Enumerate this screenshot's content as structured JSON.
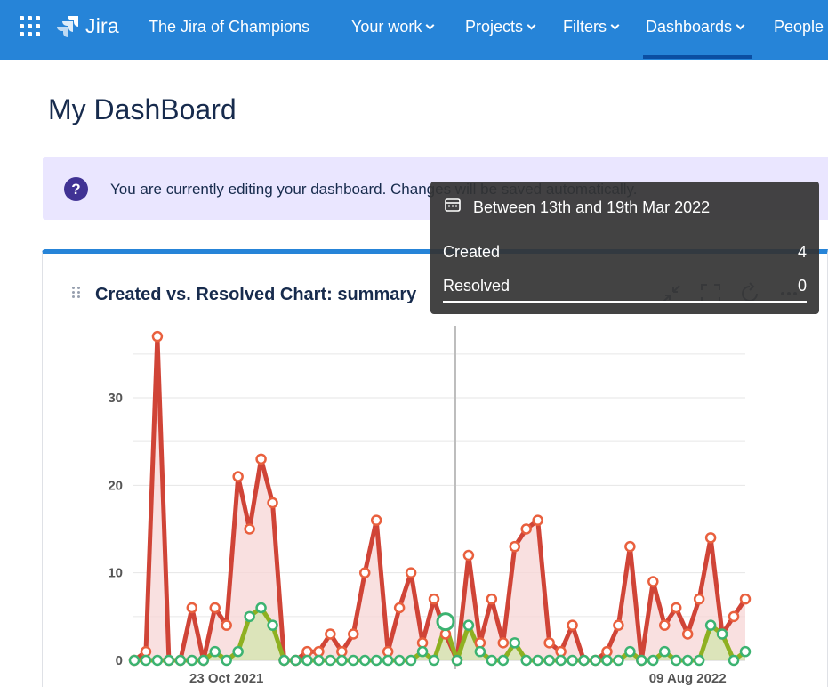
{
  "nav": {
    "product_name": "Jira",
    "site_name": "The Jira of Champions",
    "items": [
      {
        "label": "Your work"
      },
      {
        "label": "Projects"
      },
      {
        "label": "Filters"
      },
      {
        "label": "Dashboards"
      },
      {
        "label": "People"
      }
    ],
    "active": "Dashboards",
    "icons": [
      "apps-grid-icon",
      "jira-logo-icon",
      "chevron-down-icon"
    ],
    "colors": {
      "bar": "#2684d8",
      "active_indicator": "#0b4ea2"
    }
  },
  "page": {
    "title": "My DashBoard"
  },
  "banner": {
    "text": "You are currently editing your dashboard. Changes will be saved automatically.",
    "icon": "question-icon",
    "colors": {
      "background": "#eae6ff",
      "icon": "#403294"
    }
  },
  "gadget": {
    "title": "Created vs. Resolved Chart: summary",
    "icons": [
      "drag-handle-icon",
      "minimize-icon",
      "fullscreen-icon",
      "refresh-icon",
      "more-icon"
    ]
  },
  "tooltip": {
    "title": "Between 13th and 19th Mar 2022",
    "icon": "calendar-icon",
    "rows": [
      {
        "label": "Created",
        "value": "4"
      },
      {
        "label": "Resolved",
        "value": "0"
      }
    ]
  },
  "chart_data": {
    "type": "area",
    "title": "",
    "xlabel": "",
    "ylabel": "",
    "ylim": [
      0,
      38
    ],
    "y_ticks": [
      "0",
      "10",
      "20",
      "30"
    ],
    "x_tick_labels": [
      {
        "label": "23 Oct 2021",
        "index": 8
      },
      {
        "label": "09 Aug 2022",
        "index": 48
      }
    ],
    "grid": true,
    "legend": "none",
    "series": [
      {
        "name": "Created",
        "color": "#d04437",
        "fill": "#f7d6d6",
        "values": [
          0,
          1,
          37,
          0,
          0,
          6,
          0,
          6,
          4,
          21,
          15,
          23,
          18,
          0,
          0,
          1,
          1,
          3,
          1,
          3,
          10,
          16,
          1,
          6,
          10,
          2,
          7,
          3,
          0,
          12,
          2,
          7,
          2,
          13,
          15,
          16,
          2,
          1,
          4,
          0,
          0,
          1,
          4,
          13,
          0,
          9,
          4,
          6,
          3,
          7,
          14,
          3,
          5,
          7
        ]
      },
      {
        "name": "Resolved",
        "color": "#8eb021",
        "fill": "#c8e6a0",
        "values": [
          0,
          0,
          0,
          0,
          0,
          0,
          0,
          1,
          0,
          1,
          5,
          6,
          4,
          0,
          0,
          0,
          0,
          0,
          0,
          0,
          0,
          0,
          0,
          0,
          0,
          1,
          0,
          4,
          0,
          4,
          1,
          0,
          0,
          2,
          0,
          0,
          0,
          0,
          0,
          0,
          0,
          0,
          0,
          1,
          0,
          0,
          1,
          0,
          0,
          0,
          4,
          3,
          0,
          1
        ]
      }
    ],
    "hover_index": 27,
    "point_colors": {
      "created": "#e9603e",
      "resolved": "#3cb371"
    }
  }
}
